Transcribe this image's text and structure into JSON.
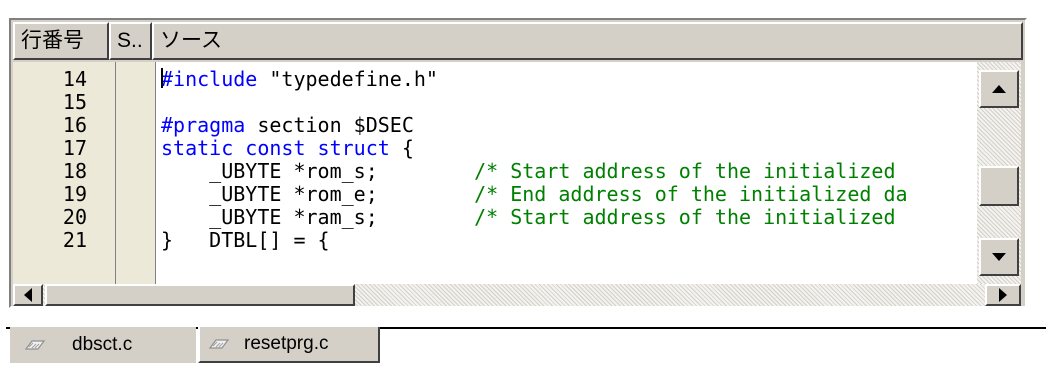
{
  "columns": {
    "line_number": "行番号",
    "status": "S..",
    "source": "ソース"
  },
  "lines": [
    {
      "num": "14",
      "parts": [
        {
          "t": "#include",
          "c": "kw"
        },
        {
          "t": " \"typedefine.h\"",
          "c": ""
        }
      ]
    },
    {
      "num": "15",
      "parts": []
    },
    {
      "num": "16",
      "parts": [
        {
          "t": "#pragma",
          "c": "kw"
        },
        {
          "t": " section $DSEC",
          "c": ""
        }
      ]
    },
    {
      "num": "17",
      "parts": [
        {
          "t": "static const struct",
          "c": "kw"
        },
        {
          "t": " {",
          "c": ""
        }
      ]
    },
    {
      "num": "18",
      "parts": [
        {
          "t": "    _UBYTE *rom_s;        ",
          "c": ""
        },
        {
          "t": "/* Start address of the initialized",
          "c": "cm"
        }
      ]
    },
    {
      "num": "19",
      "parts": [
        {
          "t": "    _UBYTE *rom_e;        ",
          "c": ""
        },
        {
          "t": "/* End address of the initialized da",
          "c": "cm"
        }
      ]
    },
    {
      "num": "20",
      "parts": [
        {
          "t": "    _UBYTE *ram_s;        ",
          "c": ""
        },
        {
          "t": "/* Start address of the initialized",
          "c": "cm"
        }
      ]
    },
    {
      "num": "21",
      "parts": [
        {
          "t": "}   DTBL[] = {",
          "c": ""
        }
      ]
    }
  ],
  "tabs": [
    {
      "label": "dbsct.c",
      "active": true,
      "icon": "file-icon"
    },
    {
      "label": "resetprg.c",
      "active": false,
      "icon": "file-icon"
    }
  ],
  "colors": {
    "keyword": "#0000ff",
    "comment": "#008000",
    "gutter": "#ece9d8",
    "chrome": "#d4d0c8"
  }
}
